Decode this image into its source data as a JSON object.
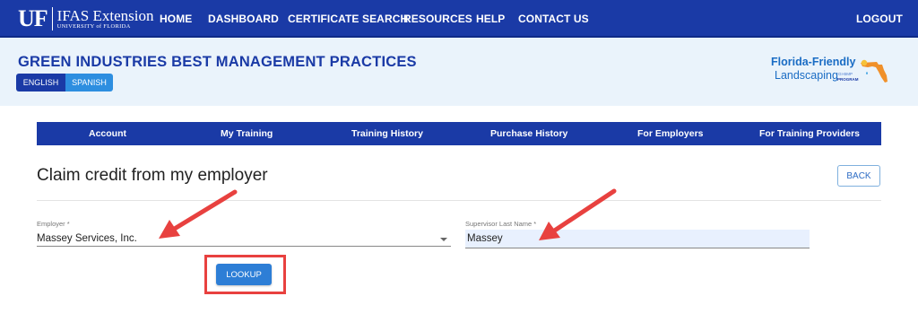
{
  "topnav": {
    "logo_uf": "UF",
    "logo_title": "IFAS Extension",
    "logo_subtitle": "UNIVERSITY of FLORIDA",
    "items": [
      "HOME",
      "DASHBOARD",
      "CERTIFICATE SEARCH",
      "RESOURCES",
      "HELP",
      "CONTACT US"
    ],
    "logout": "LOGOUT"
  },
  "header": {
    "title": "GREEN INDUSTRIES BEST MANAGEMENT PRACTICES",
    "languages": [
      "ENGLISH",
      "SPANISH"
    ],
    "partner_logo": {
      "line1": "Florida-Friendly",
      "line2": "Landscaping",
      "tag_small": "GI-BMP",
      "tag_program": "PROGRAM"
    }
  },
  "tabs": [
    "Account",
    "My Training",
    "Training History",
    "Purchase History",
    "For Employers",
    "For Training Providers"
  ],
  "page": {
    "title": "Claim credit from my employer",
    "back_label": "BACK"
  },
  "form": {
    "employer_label": "Employer *",
    "employer_value": "Massey Services, Inc.",
    "supervisor_label": "Supervisor Last Name *",
    "supervisor_value": "Massey",
    "lookup_label": "LOOKUP"
  },
  "colors": {
    "primary_blue": "#1a3aa6",
    "accent_blue": "#2d7ed6",
    "annotation_red": "#e8413f"
  }
}
